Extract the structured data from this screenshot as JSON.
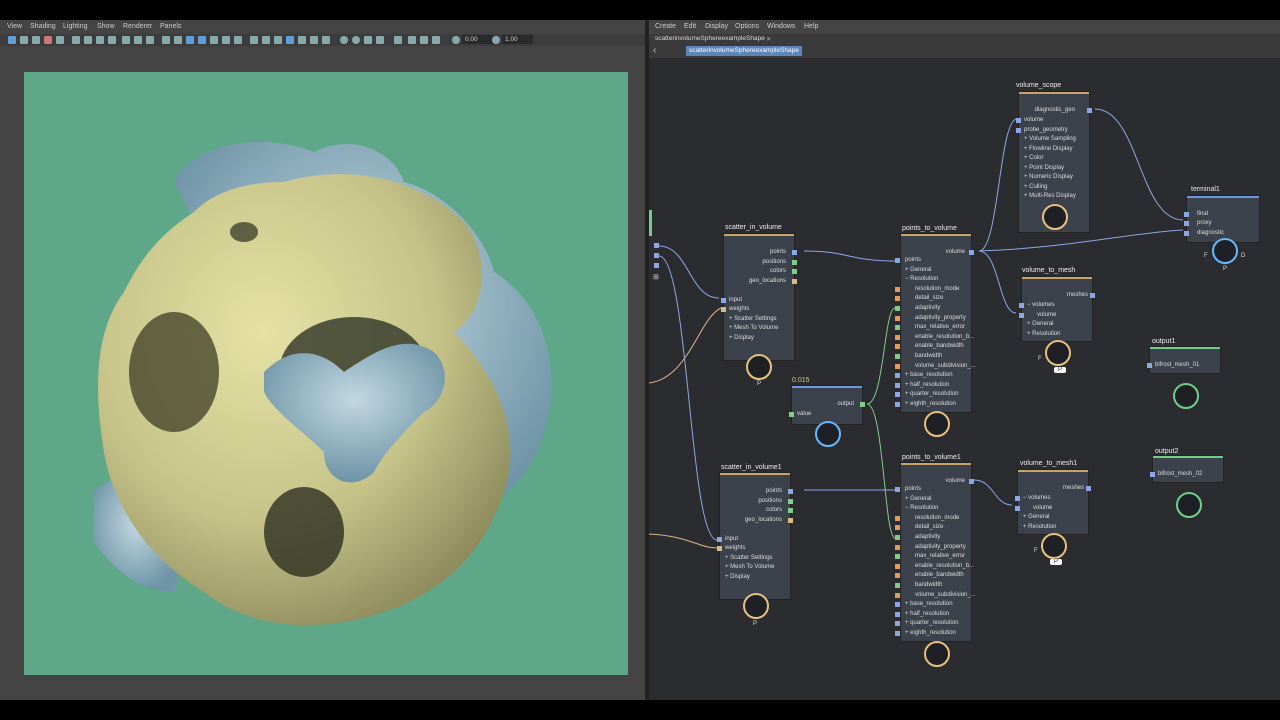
{
  "viewport": {
    "menu": [
      "View",
      "Shading",
      "Lighting",
      "Show",
      "Renderer",
      "Panels"
    ],
    "field_a": "0.00",
    "field_b": "1.00"
  },
  "node_editor": {
    "menu": [
      "Create",
      "Edit",
      "Display",
      "Options",
      "Windows",
      "Help"
    ],
    "tab": "scatterinvolumeSphereexampleShape",
    "tab_close": "✕",
    "breadcrumb": "scatterinvolumeSphereexampleShape",
    "float_value": "0.015",
    "nodes": {
      "volume_scope": {
        "title": "volume_scope",
        "out": "diagnostic_geo",
        "rows": [
          "volume",
          "probe_geometry",
          "+ Volume Sampling",
          "+ Flowline Display",
          "+ Color",
          "+ Point Display",
          "+ Numeric Display",
          "+ Culling",
          "+ Multi-Res Display"
        ]
      },
      "terminal1": {
        "title": "terminal1",
        "rows": [
          "final",
          "proxy",
          "diagnostic"
        ],
        "badge_left": "F",
        "badge_right": "D",
        "badge_bottom": "P"
      },
      "scatter_in_volume": {
        "title": "scatter_in_volume",
        "outs": [
          "points",
          "positions",
          "colors",
          "geo_locations"
        ],
        "ins": [
          "input",
          "weights",
          "+ Scatter Settings",
          "+ Mesh To Volume",
          "+ Display"
        ],
        "badge": "P"
      },
      "points_to_volume": {
        "title": "points_to_volume",
        "out": "volume",
        "rows": [
          "points",
          "+ General",
          "− Resolution",
          "resolution_mode",
          "detail_size",
          "adaptivity",
          "adaptivity_property",
          "max_relative_error",
          "enable_resolution_b...",
          "enable_bandwidth",
          "bandwidth",
          "volume_subdivision_...",
          "+ base_resolution",
          "+ half_resolution",
          "+ quarter_resolution",
          "+ eighth_resolution"
        ]
      },
      "volume_to_mesh": {
        "title": "volume_to_mesh",
        "out": "meshes",
        "rows": [
          "− volumes",
          "volume",
          "+ General",
          "+ Resolution"
        ],
        "badge_left": "F",
        "badge_bottom": "P"
      },
      "value_node": {
        "row": "value",
        "out": "output"
      },
      "output1": {
        "title": "output1",
        "row": "bifrost_mesh_01"
      },
      "output2": {
        "title": "output2",
        "row": "bifrost_mesh_02"
      },
      "scatter_in_volume1": {
        "title": "scatter_in_volume1",
        "outs": [
          "points",
          "positions",
          "colors",
          "geo_locations"
        ],
        "ins": [
          "input",
          "weights",
          "+ Scatter Settings",
          "+ Mesh To Volume",
          "+ Display"
        ],
        "badge": "P"
      },
      "points_to_volume1": {
        "title": "points_to_volume1",
        "out": "volume",
        "rows": [
          "points",
          "+ General",
          "− Resolution",
          "resolution_mode",
          "detail_size",
          "adaptivity",
          "adaptivity_property",
          "max_relative_error",
          "enable_resolution_b...",
          "enable_bandwidth",
          "bandwidth",
          "volume_subdivision_...",
          "+ base_resolution",
          "+ half_resolution",
          "+ quarter_resolution",
          "+ eighth_resolution"
        ]
      },
      "volume_to_mesh1": {
        "title": "volume_to_mesh1",
        "out": "meshes",
        "rows": [
          "− volumes",
          "volume",
          "+ General",
          "+ Resolution"
        ],
        "badge_left": "F",
        "badge_bottom": "P"
      }
    }
  },
  "colors": {
    "render_bg": "#5ea889",
    "sphere_yellow": "#c9c98c",
    "sphere_blue": "#8fb7c9",
    "wire_blue": "#8da6e6",
    "wire_green": "#7fcf8a",
    "wire_tan": "#d8b98a",
    "accent_orange": "#e8c17e"
  }
}
